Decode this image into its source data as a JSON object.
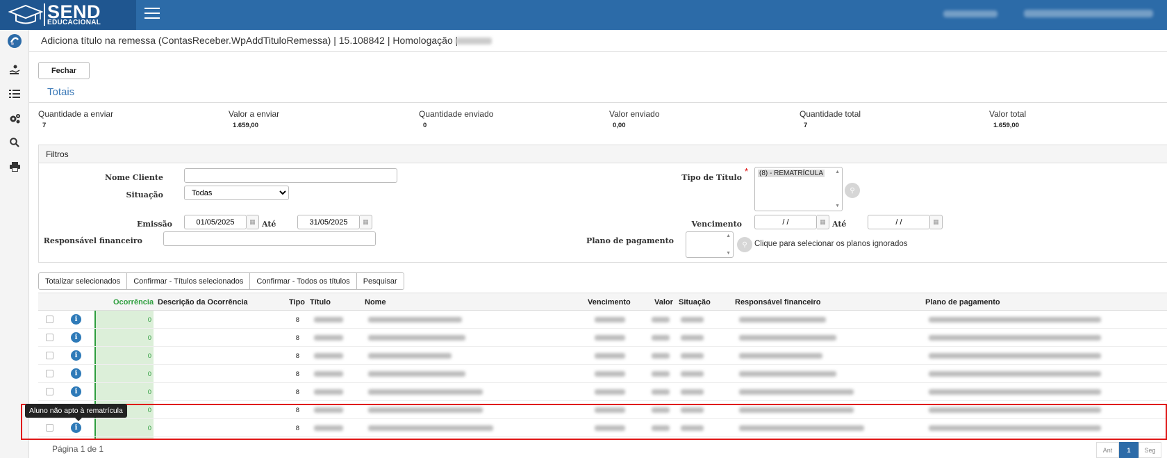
{
  "header": {
    "logo_text": "SEND",
    "logo_subtext": "EDUCACIONAL",
    "menu_icon": "hamburger-icon"
  },
  "sidebar": {
    "icons": [
      "send-logo-icon",
      "hand-coin-icon",
      "list-check-icon",
      "gears-icon",
      "search-icon",
      "printer-icon"
    ]
  },
  "page": {
    "title": "Adiciona título na remessa (ContasReceber.WpAddTituloRemessa) | 15.108842 | Homologação |",
    "close_label": "Fechar"
  },
  "totals": {
    "heading": "Totais",
    "items": [
      {
        "label": "Quantidade a enviar",
        "value": "7"
      },
      {
        "label": "Valor a enviar",
        "value": "1.659,00"
      },
      {
        "label": "Quantidade enviado",
        "value": "0"
      },
      {
        "label": "Valor enviado",
        "value": "0,00"
      },
      {
        "label": "Quantidade total",
        "value": "7"
      },
      {
        "label": "Valor total",
        "value": "1.659,00"
      }
    ]
  },
  "filters": {
    "heading": "Filtros",
    "nome_cliente_label": "Nome Cliente",
    "nome_cliente_value": "",
    "situacao_label": "Situação",
    "situacao_value": "Todas",
    "emissao_label": "Emissão",
    "emissao_de": "01/05/2025",
    "ate_label": "Até",
    "emissao_ate": "31/05/2025",
    "responsavel_label": "Responsável financeiro",
    "responsavel_value": "",
    "tipo_titulo_label": "Tipo de Título",
    "tipo_titulo_required": "*",
    "tipo_titulo_selected": "(8) - REMATRÍCULA",
    "vencimento_label": "Vencimento",
    "vencimento_de": " / / ",
    "vencimento_ate_label": "Até",
    "vencimento_ate": " / / ",
    "plano_label": "Plano de pagamento",
    "plano_hint": "Clique para selecionar os planos ignorados"
  },
  "actions": {
    "totalizar": "Totalizar selecionados",
    "confirmar_selecionados": "Confirmar - Títulos selecionados",
    "confirmar_todos": "Confirmar - Todos os títulos",
    "pesquisar": "Pesquisar"
  },
  "grid": {
    "columns": [
      "Ocorrência",
      "Descrição da Ocorrência",
      "Tipo",
      "Título",
      "Nome",
      "Vencimento",
      "Valor",
      "Situação",
      "Responsável financeiro",
      "Plano de pagamento"
    ],
    "rows": [
      {
        "ocorrencia": "0",
        "tipo": "8"
      },
      {
        "ocorrencia": "0",
        "tipo": "8"
      },
      {
        "ocorrencia": "0",
        "tipo": "8"
      },
      {
        "ocorrencia": "0",
        "tipo": "8"
      },
      {
        "ocorrencia": "0",
        "tipo": "8"
      },
      {
        "ocorrencia": "0",
        "tipo": "8"
      },
      {
        "ocorrencia": "0",
        "tipo": "8"
      }
    ],
    "tooltip": "Aluno não apto à rematrícula"
  },
  "pager": {
    "text": "Página 1 de 1",
    "prev": "Ant",
    "current": "1",
    "next": "Seg"
  },
  "colors": {
    "header_bg": "#2c6ba8",
    "accent": "#3b79b7",
    "occurrence_green": "#2e9e3e",
    "highlight_red": "#e01818"
  }
}
